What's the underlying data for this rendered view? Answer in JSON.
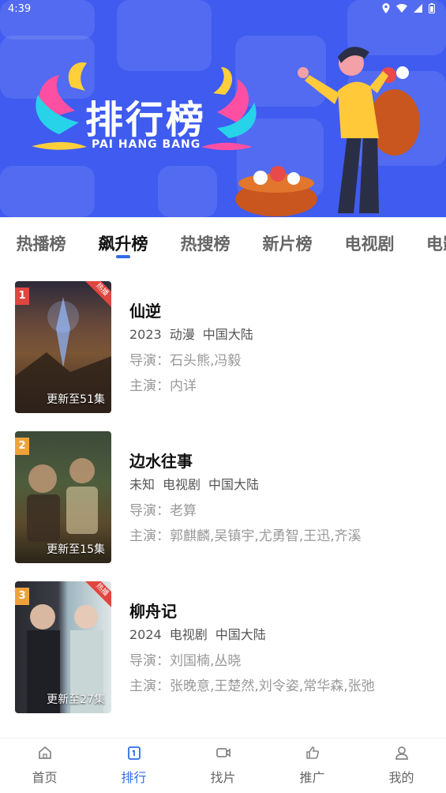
{
  "status_bar": {
    "time": "4:39"
  },
  "banner": {
    "title": "排行榜",
    "subtitle": "PAI HANG BANG"
  },
  "tabs": [
    {
      "label": "热播榜",
      "active": false
    },
    {
      "label": "飙升榜",
      "active": true
    },
    {
      "label": "热搜榜",
      "active": false
    },
    {
      "label": "新片榜",
      "active": false
    },
    {
      "label": "电视剧",
      "active": false
    },
    {
      "label": "电影",
      "active": false
    }
  ],
  "items": [
    {
      "rank": "1",
      "corner": "热播",
      "update": "更新至51集",
      "title": "仙逆",
      "year": "2023",
      "genre": "动漫",
      "region": "中国大陆",
      "director": "导演：石头熊,冯毅",
      "cast": "主演：内详",
      "rank_color": "#e0463e"
    },
    {
      "rank": "2",
      "corner": "",
      "update": "更新至15集",
      "title": "边水往事",
      "year": "未知",
      "genre": "电视剧",
      "region": "中国大陆",
      "director": "导演：老算",
      "cast": "主演：郭麒麟,吴镇宇,尤勇智,王迅,齐溪",
      "rank_color": "#f0a23a"
    },
    {
      "rank": "3",
      "corner": "热播",
      "update": "更新至27集",
      "title": "柳舟记",
      "year": "2024",
      "genre": "电视剧",
      "region": "中国大陆",
      "director": "导演：刘国楠,丛晓",
      "cast": "主演：张晚意,王楚然,刘令姿,常华森,张弛",
      "rank_color": "#f0a23a"
    }
  ],
  "nav": [
    {
      "label": "首页",
      "icon": "home-icon",
      "active": false
    },
    {
      "label": "排行",
      "icon": "ranking-icon",
      "active": true
    },
    {
      "label": "找片",
      "icon": "video-icon",
      "active": false
    },
    {
      "label": "推广",
      "icon": "thumb-up-icon",
      "active": false
    },
    {
      "label": "我的",
      "icon": "user-icon",
      "active": false
    }
  ]
}
